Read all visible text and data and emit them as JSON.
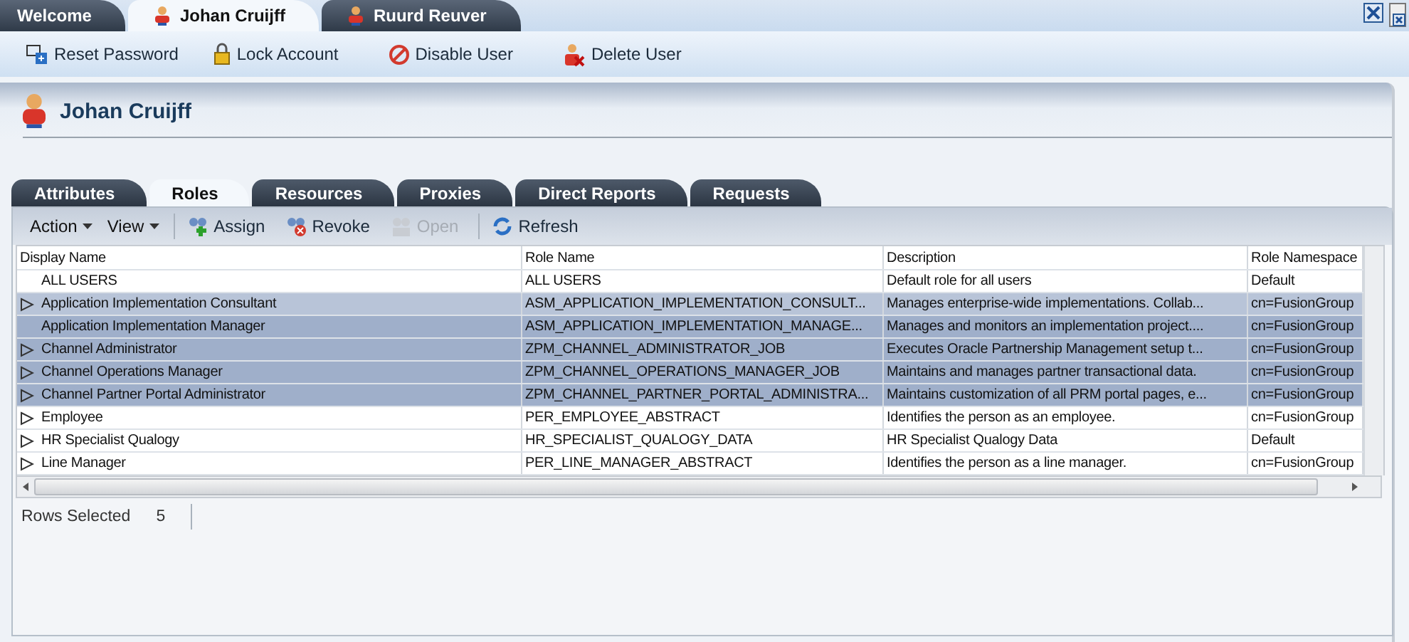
{
  "doc_tabs": [
    {
      "label": "Welcome",
      "selected": false,
      "user_icon": false
    },
    {
      "label": "Johan Cruijff",
      "selected": true,
      "user_icon": true
    },
    {
      "label": "Ruurd Reuver",
      "selected": false,
      "user_icon": true
    }
  ],
  "actions": [
    {
      "label": "Reset Password",
      "kind": "reset"
    },
    {
      "label": "Lock Account",
      "kind": "lock"
    },
    {
      "label": "Disable User",
      "kind": "disable"
    },
    {
      "label": "Delete User",
      "kind": "delete"
    }
  ],
  "user_title": "Johan Cruijff",
  "tabs": [
    {
      "label": "Attributes",
      "selected": false
    },
    {
      "label": "Roles",
      "selected": true
    },
    {
      "label": "Resources",
      "selected": false
    },
    {
      "label": "Proxies",
      "selected": false
    },
    {
      "label": "Direct Reports",
      "selected": false
    },
    {
      "label": "Requests",
      "selected": false
    }
  ],
  "toolbar": {
    "menus": [
      "Action",
      "View"
    ],
    "buttons": [
      {
        "label": "Assign",
        "kind": "assign",
        "disabled": false
      },
      {
        "label": "Revoke",
        "kind": "revoke",
        "disabled": false
      },
      {
        "label": "Open",
        "kind": "open",
        "disabled": true
      },
      {
        "label": "Refresh",
        "kind": "refresh",
        "disabled": false
      }
    ]
  },
  "table": {
    "columns": [
      "Display Name",
      "Role Name",
      "Description",
      "Role Namespace"
    ],
    "rows": [
      {
        "cells": [
          "ALL USERS",
          "ALL USERS",
          "Default role for all users",
          "Default"
        ],
        "selected": false,
        "expandable": false
      },
      {
        "cells": [
          "Application Implementation Consultant",
          "ASM_APPLICATION_IMPLEMENTATION_CONSULT...",
          "Manages enterprise-wide implementations. Collab...",
          "cn=FusionGroup"
        ],
        "selected": true,
        "expandable": true
      },
      {
        "cells": [
          "Application Implementation Manager",
          "ASM_APPLICATION_IMPLEMENTATION_MANAGE...",
          "Manages and monitors an implementation project....",
          "cn=FusionGroup"
        ],
        "selected": true,
        "expandable": false
      },
      {
        "cells": [
          "Channel Administrator",
          "ZPM_CHANNEL_ADMINISTRATOR_JOB",
          "Executes Oracle Partnership Management setup t...",
          "cn=FusionGroup"
        ],
        "selected": true,
        "expandable": true
      },
      {
        "cells": [
          "Channel Operations Manager",
          "ZPM_CHANNEL_OPERATIONS_MANAGER_JOB",
          "Maintains and manages partner transactional data.",
          "cn=FusionGroup"
        ],
        "selected": true,
        "expandable": true
      },
      {
        "cells": [
          "Channel Partner Portal Administrator",
          "ZPM_CHANNEL_PARTNER_PORTAL_ADMINISTRA...",
          "Maintains customization of all PRM portal pages, e...",
          "cn=FusionGroup"
        ],
        "selected": true,
        "expandable": true
      },
      {
        "cells": [
          "Employee",
          "PER_EMPLOYEE_ABSTRACT",
          "Identifies the person as an employee.",
          "cn=FusionGroup"
        ],
        "selected": false,
        "expandable": true
      },
      {
        "cells": [
          "HR Specialist Qualogy",
          "HR_SPECIALIST_QUALOGY_DATA",
          "HR Specialist Qualogy Data",
          "Default"
        ],
        "selected": false,
        "expandable": true
      },
      {
        "cells": [
          "Line Manager",
          "PER_LINE_MANAGER_ABSTRACT",
          "Identifies the person as a line manager.",
          "cn=FusionGroup"
        ],
        "selected": false,
        "expandable": true
      }
    ]
  },
  "footer": {
    "label": "Rows Selected",
    "count": "5"
  }
}
